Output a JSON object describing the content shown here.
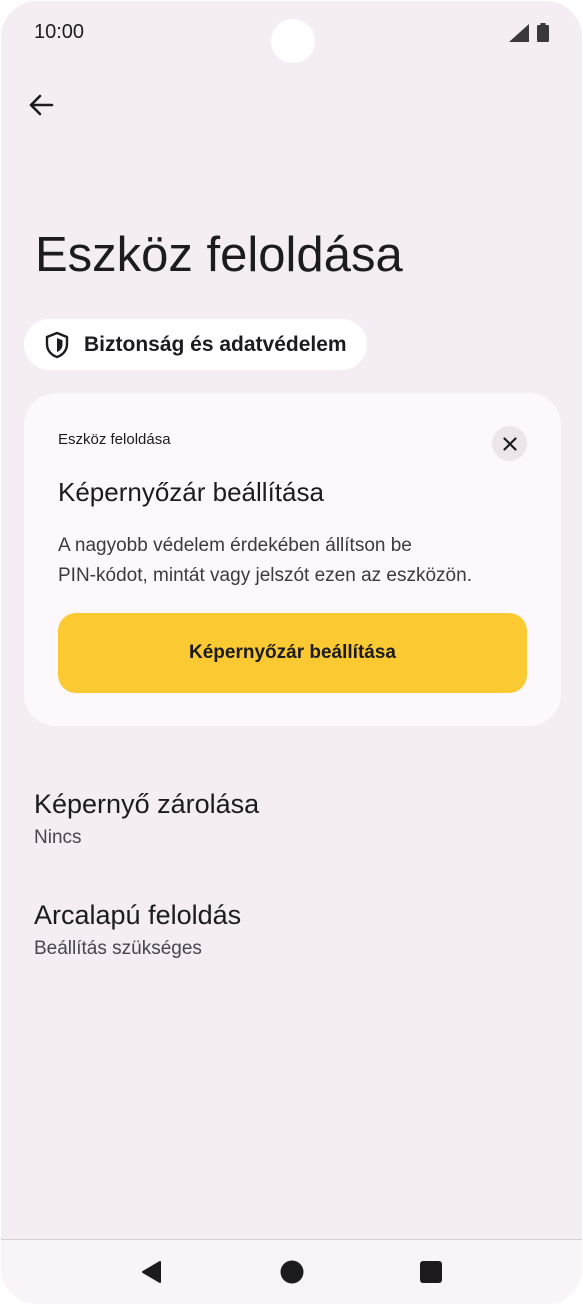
{
  "status_bar": {
    "time": "10:00",
    "icons": [
      "signal-icon",
      "battery-icon"
    ]
  },
  "app_bar": {
    "back_icon": "arrow-back-icon"
  },
  "page": {
    "title": "Eszköz feloldása"
  },
  "breadcrumb": {
    "icon": "shield-icon",
    "label": "Biztonság és adatvédelem"
  },
  "suggestion_card": {
    "overline": "Eszköz feloldása",
    "close_icon": "close-icon",
    "title": "Képernyőzár beállítása",
    "body_line1": "A nagyobb védelem érdekében állítson be",
    "body_line2": "PIN-kódot, mintát vagy jelszót ezen az eszközön.",
    "button_label": "Képernyőzár beállítása",
    "button_color": "#fbc932"
  },
  "settings": [
    {
      "title": "Képernyő zárolása",
      "summary": "Nincs"
    },
    {
      "title": "Arcalapú feloldás",
      "summary": "Beállítás szükséges"
    }
  ],
  "nav_bar": {
    "icons": [
      "back-triangle-icon",
      "home-circle-icon",
      "recents-square-icon"
    ]
  },
  "colors": {
    "background": "#f4eef4",
    "card": "#fcf8fb",
    "accent": "#fbc932"
  }
}
